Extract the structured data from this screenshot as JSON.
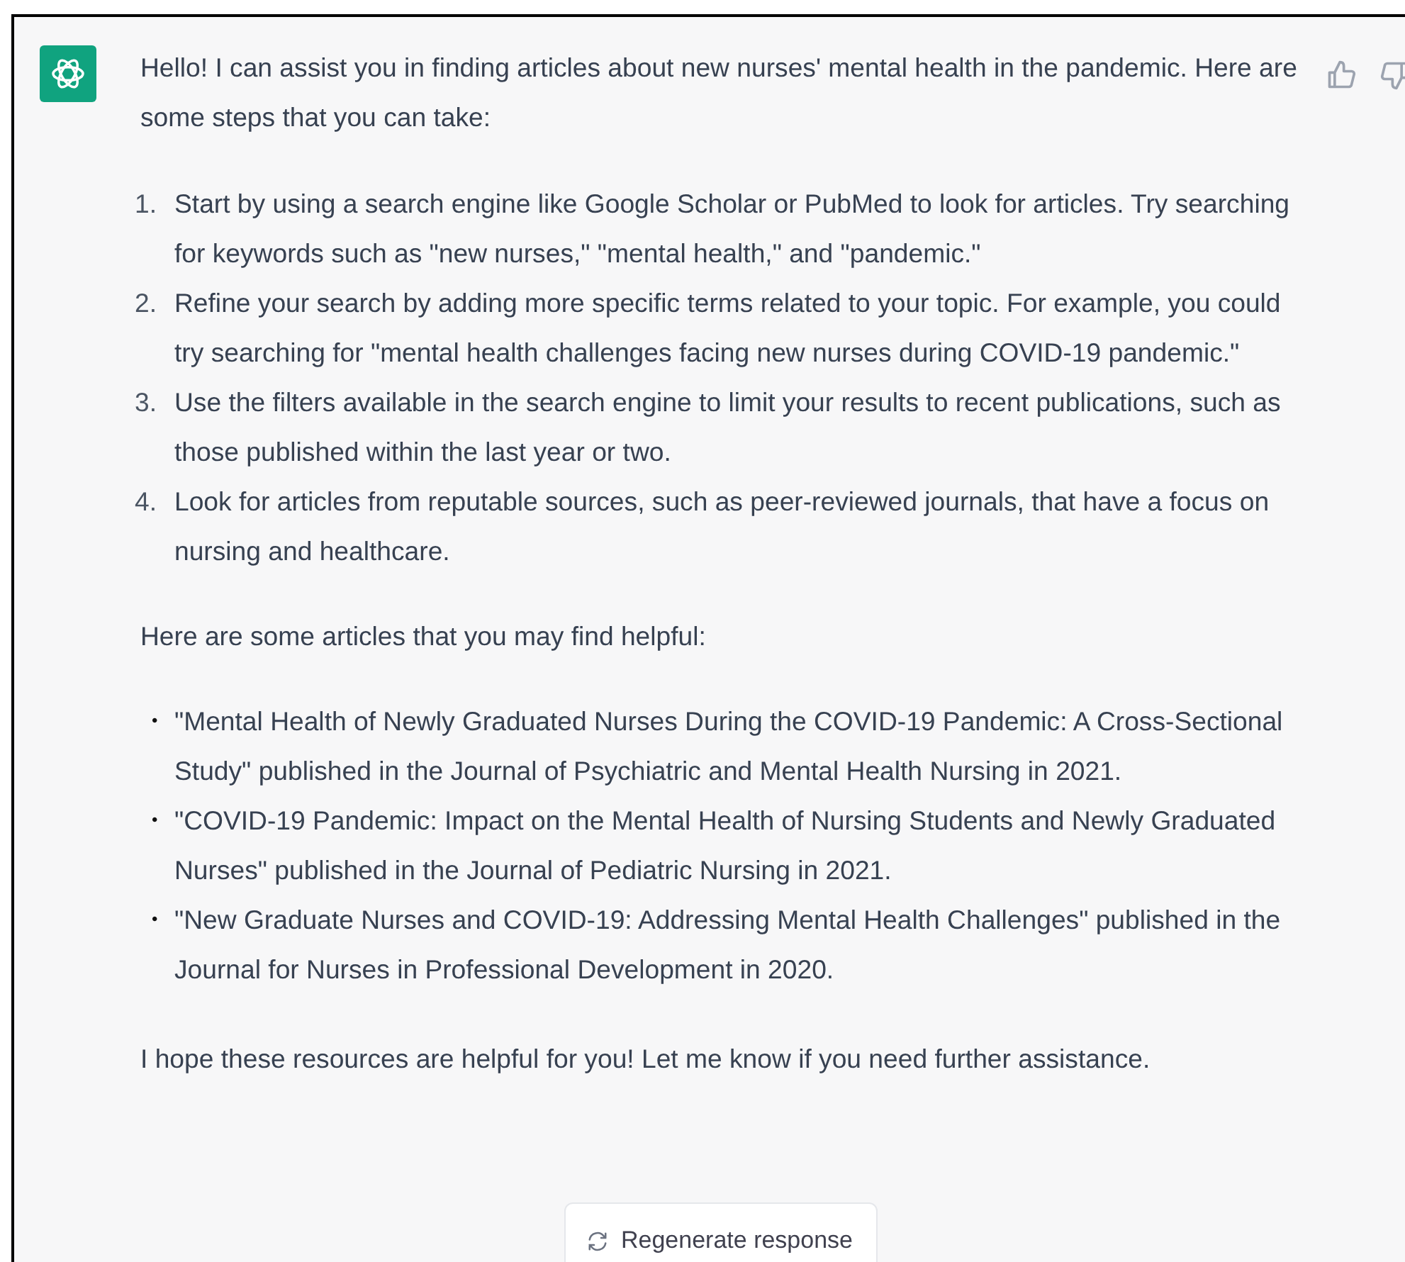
{
  "message": {
    "intro": "Hello! I can assist you in finding articles about new nurses' mental health in the pandemic. Here are some steps that you can take:",
    "steps": [
      {
        "number": "1.",
        "text": "Start by using a search engine like Google Scholar or PubMed to look for articles. Try searching for keywords such as \"new nurses,\" \"mental health,\" and \"pandemic.\""
      },
      {
        "number": "2.",
        "text": "Refine your search by adding more specific terms related to your topic. For example, you could try searching for \"mental health challenges facing new nurses during COVID-19 pandemic.\""
      },
      {
        "number": "3.",
        "text": "Use the filters available in the search engine to limit your results to recent publications, such as those published within the last year or two."
      },
      {
        "number": "4.",
        "text": "Look for articles from reputable sources, such as peer-reviewed journals, that have a focus on nursing and healthcare."
      }
    ],
    "articles_intro": "Here are some articles that you may find helpful:",
    "articles": [
      {
        "bullet": "•",
        "text": "\"Mental Health of Newly Graduated Nurses During the COVID-19 Pandemic: A Cross-Sectional Study\" published in the Journal of Psychiatric and Mental Health Nursing in 2021."
      },
      {
        "bullet": "•",
        "text": "\"COVID-19 Pandemic: Impact on the Mental Health of Nursing Students and Newly Graduated Nurses\" published in the Journal of Pediatric Nursing in 2021."
      },
      {
        "bullet": "•",
        "text": "\"New Graduate Nurses and COVID-19: Addressing Mental Health Challenges\" published in the Journal for Nurses in Professional Development in 2020."
      }
    ],
    "closing": "I hope these resources are helpful for you! Let me know if you need further assistance."
  },
  "regenerate_button": {
    "label": "Regenerate response"
  }
}
